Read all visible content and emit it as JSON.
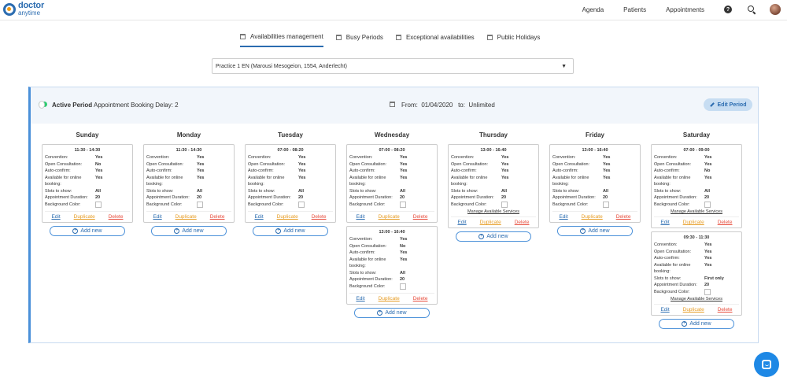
{
  "brand": {
    "line1": "doctor",
    "line2": "anytime"
  },
  "nav": {
    "agenda": "Agenda",
    "patients": "Patients",
    "appointments": "Appointments",
    "help_glyph": "?"
  },
  "tabs": [
    "Availabilities management",
    "Busy Periods",
    "Exceptional availabilities",
    "Public Holidays"
  ],
  "active_tab": 0,
  "practice": {
    "value": "Practice 1 EN (Marousi Mesogeion, 1554, Anderlecht)",
    "arrow": "▼"
  },
  "period": {
    "active_label": "Active Period",
    "booking_delay": "Appointment Booking Delay: 2",
    "from_label": "From:",
    "from_date": "01/04/2020",
    "to_label": "to:",
    "to_value": "Unlimited",
    "edit_label": "Edit Period"
  },
  "labels": {
    "convention": "Convention:",
    "open_consultation": "Open Consultation:",
    "auto_confirm": "Auto-confirm:",
    "online_1": "Available for online",
    "online_2": "booking:",
    "slots": "Slots to show:",
    "duration": "Appointment Duration:",
    "bg": "Background Color:",
    "manage": "Manage Available Services",
    "edit": "Edit",
    "duplicate": "Duplicate",
    "delete": "Delete",
    "add_new": "Add new"
  },
  "days": [
    {
      "name": "Sunday",
      "slots": [
        {
          "time": "11:30 - 14:30",
          "convention": "Yes",
          "open": "No",
          "auto": "Yes",
          "online": "Yes",
          "slots": "All",
          "duration": "20",
          "manage": false
        }
      ]
    },
    {
      "name": "Monday",
      "slots": [
        {
          "time": "11:30 - 14:30",
          "convention": "Yes",
          "open": "Yes",
          "auto": "Yes",
          "online": "Yes",
          "slots": "All",
          "duration": "20",
          "manage": false
        }
      ]
    },
    {
      "name": "Tuesday",
      "slots": [
        {
          "time": "07:00 - 08:20",
          "convention": "Yes",
          "open": "Yes",
          "auto": "Yes",
          "online": "Yes",
          "slots": "All",
          "duration": "20",
          "manage": false
        }
      ]
    },
    {
      "name": "Wednesday",
      "slots": [
        {
          "time": "07:00 - 08:20",
          "convention": "Yes",
          "open": "Yes",
          "auto": "Yes",
          "online": "Yes",
          "slots": "All",
          "duration": "20",
          "manage": false
        },
        {
          "time": "13:00 - 16:40",
          "convention": "Yes",
          "open": "No",
          "auto": "Yes",
          "online": "Yes",
          "slots": "All",
          "duration": "20",
          "manage": false
        }
      ]
    },
    {
      "name": "Thursday",
      "slots": [
        {
          "time": "13:00 - 16:40",
          "convention": "Yes",
          "open": "Yes",
          "auto": "Yes",
          "online": "Yes",
          "slots": "All",
          "duration": "20",
          "manage": true
        }
      ]
    },
    {
      "name": "Friday",
      "slots": [
        {
          "time": "13:00 - 16:40",
          "convention": "Yes",
          "open": "Yes",
          "auto": "Yes",
          "online": "Yes",
          "slots": "All",
          "duration": "20",
          "manage": false
        }
      ]
    },
    {
      "name": "Saturday",
      "slots": [
        {
          "time": "07:00 - 09:00",
          "convention": "Yes",
          "open": "Yes",
          "auto": "No",
          "online": "Yes",
          "slots": "All",
          "duration": "20",
          "manage": true
        },
        {
          "time": "09:30 - 11:30",
          "convention": "Yes",
          "open": "Yes",
          "auto": "Yes",
          "online": "Yes",
          "slots": "First only",
          "duration": "20",
          "manage": true
        }
      ]
    }
  ],
  "colors": {
    "accent": "#2b6cb0",
    "toggle": "#2ecc71",
    "duplicate": "#e69c24",
    "delete": "#e74c3c",
    "chat": "#1e88e5"
  }
}
